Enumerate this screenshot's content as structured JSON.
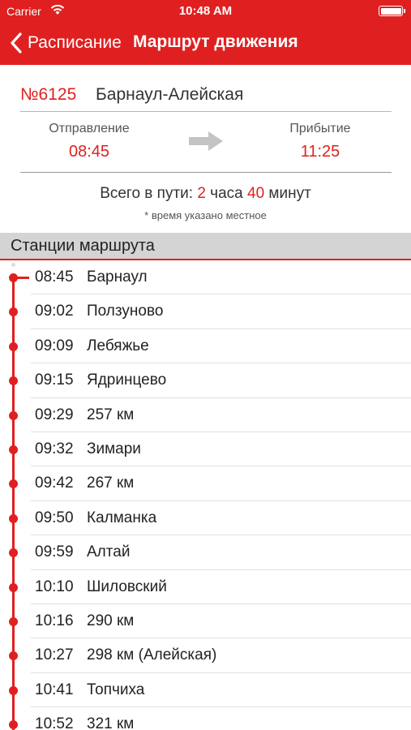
{
  "status": {
    "carrier": "Carrier",
    "time": "10:48 AM"
  },
  "nav": {
    "back_label": "Расписание",
    "title": "Маршрут движения"
  },
  "train": {
    "number": "№6125",
    "route": "Барнаул-Алейская"
  },
  "times": {
    "departure_label": "Отправление",
    "departure": "08:45",
    "arrival_label": "Прибытие",
    "arrival": "11:25"
  },
  "total": {
    "prefix": "Всего в пути: ",
    "hours": "2",
    "hours_unit": " часа ",
    "minutes": "40",
    "minutes_unit": " минут"
  },
  "note": "* время указано местное",
  "section_title": "Станции маршрута",
  "stations": [
    {
      "time": "08:45",
      "name": "Барнаул"
    },
    {
      "time": "09:02",
      "name": "Ползуново"
    },
    {
      "time": "09:09",
      "name": "Лебяжье"
    },
    {
      "time": "09:15",
      "name": "Ядринцево"
    },
    {
      "time": "09:29",
      "name": "257 км"
    },
    {
      "time": "09:32",
      "name": "Зимари"
    },
    {
      "time": "09:42",
      "name": "267 км"
    },
    {
      "time": "09:50",
      "name": "Калманка"
    },
    {
      "time": "09:59",
      "name": "Алтай"
    },
    {
      "time": "10:10",
      "name": "Шиловский"
    },
    {
      "time": "10:16",
      "name": "290 км"
    },
    {
      "time": "10:27",
      "name": "298 км (Алейская)"
    },
    {
      "time": "10:41",
      "name": "Топчиха"
    },
    {
      "time": "10:52",
      "name": "321 км"
    }
  ],
  "colors": {
    "accent": "#e02020",
    "section_bg": "#d4d4d4"
  }
}
